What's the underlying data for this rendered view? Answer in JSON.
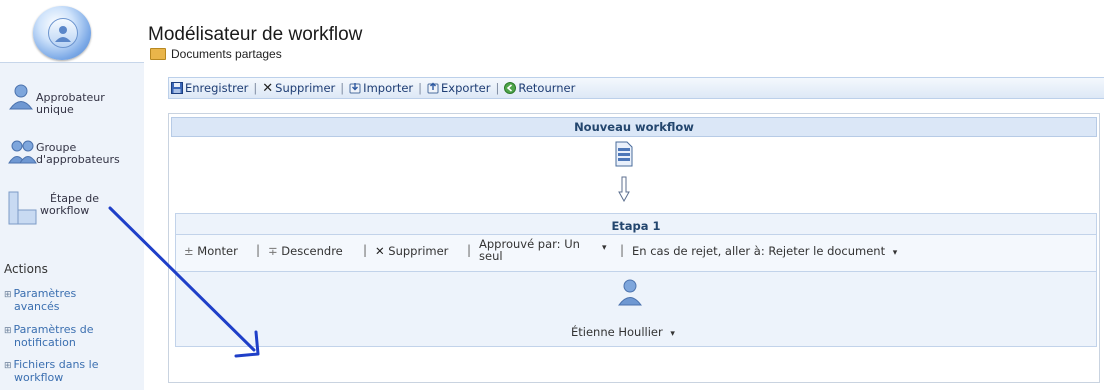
{
  "header": {
    "title": "Modélisateur de workflow",
    "breadcrumb": "Documents partages"
  },
  "sidebar": {
    "palette": [
      {
        "line1": "Approbateur",
        "line2": "unique",
        "icon": "single-user-icon"
      },
      {
        "line1": "Groupe",
        "line2": "d'approbateurs",
        "icon": "group-users-icon"
      },
      {
        "line1": "Étape de",
        "line2": "workflow",
        "icon": "workflow-step-icon"
      }
    ],
    "actions_title": "Actions",
    "actions": [
      {
        "line1": "Paramètres",
        "line2": "avancés"
      },
      {
        "line1": "Paramètres de",
        "line2": "notification"
      },
      {
        "line1": "Fichiers dans le",
        "line2": "workflow"
      }
    ]
  },
  "toolbar": {
    "save": "Enregistrer",
    "delete": "Supprimer",
    "import": "Importer",
    "export": "Exporter",
    "back": "Retourner",
    "separator": "|"
  },
  "workflow": {
    "title": "Nouveau workflow",
    "step": {
      "title": "Etapa 1",
      "move_up": "Monter",
      "move_down": "Descendre",
      "delete": "Supprimer",
      "approved_by_line1": "Approuvé par: Un",
      "approved_by_line2": "seul",
      "reject_action": "En cas de rejet, aller à: Rejeter le document",
      "approver": "Étienne Houllier"
    }
  },
  "colors": {
    "accent": "#1f3fc8",
    "panel_header": "#dbe7f7",
    "sidebar_bg": "#eef3fa"
  }
}
